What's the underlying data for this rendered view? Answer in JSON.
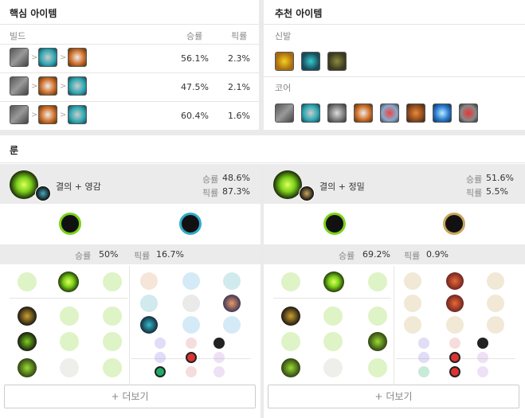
{
  "core_items": {
    "title": "핵심 아이템",
    "col_build": "빌드",
    "col_winrate": "승률",
    "col_pickrate": "픽률",
    "rows": [
      {
        "winrate": "56.1%",
        "pickrate": "2.3%"
      },
      {
        "winrate": "47.5%",
        "pickrate": "2.1%"
      },
      {
        "winrate": "60.4%",
        "pickrate": "1.6%"
      }
    ]
  },
  "recommended": {
    "title": "추천 아이템",
    "boots_label": "신발",
    "core_label": "코어"
  },
  "runes": {
    "title": "룬",
    "pages": [
      {
        "name": "결의 + 영감",
        "winrate_label": "승률",
        "winrate": "48.6%",
        "pickrate_label": "픽률",
        "pickrate": "87.3%",
        "detail_winrate_label": "승률",
        "detail_winrate": "50%",
        "detail_pickrate_label": "픽률",
        "detail_pickrate": "16.7%",
        "more": "+ 더보기"
      },
      {
        "name": "결의 + 정밀",
        "winrate_label": "승률",
        "winrate": "51.6%",
        "pickrate_label": "픽률",
        "pickrate": "5.5%",
        "detail_winrate_label": "승률",
        "detail_winrate": "69.2%",
        "detail_pickrate_label": "픽률",
        "detail_pickrate": "0.9%",
        "more": "+ 더보기"
      }
    ]
  },
  "colors": {
    "resolve_green": "#7cd11a",
    "item_gold": "#b08a3a",
    "item_teal": "#2aa6b0",
    "item_orange": "#d0702a",
    "band_gray": "#ebebeb"
  }
}
